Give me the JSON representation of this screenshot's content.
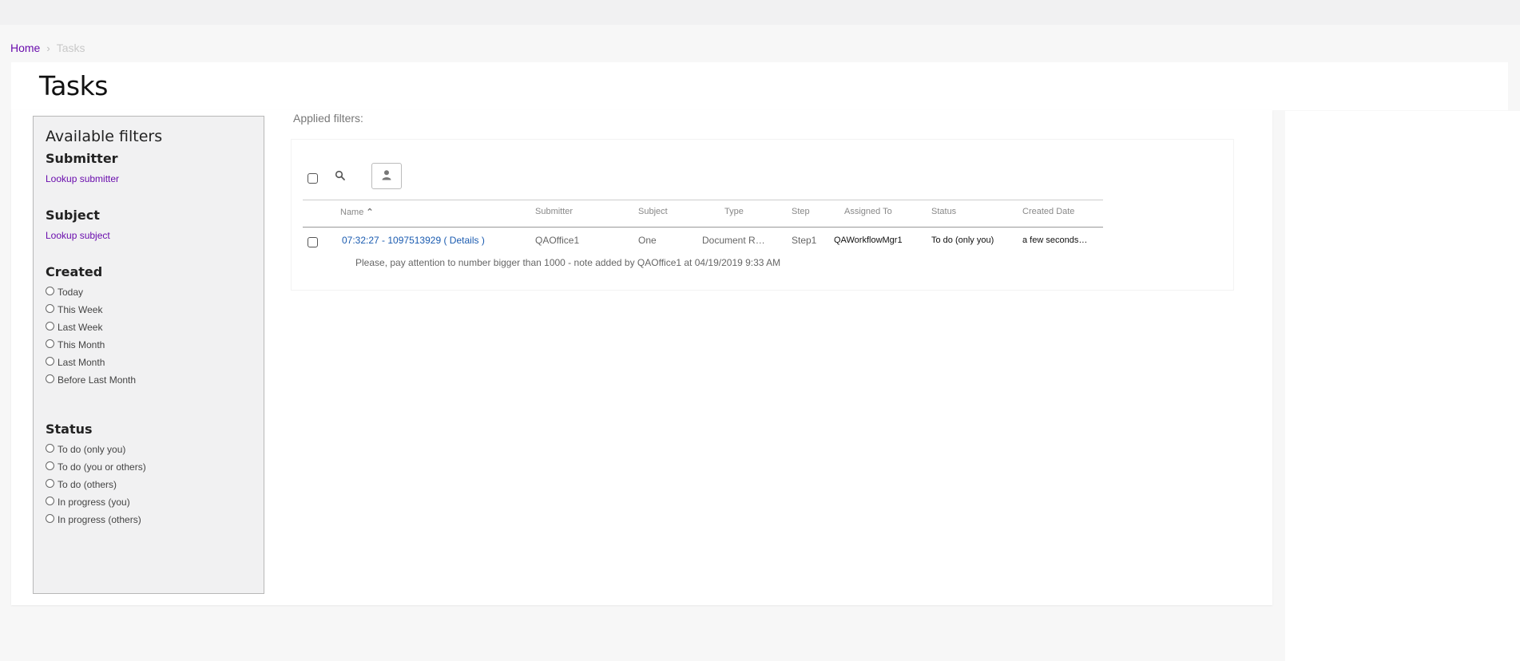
{
  "breadcrumb": {
    "home": "Home",
    "separator": "›",
    "current": "Tasks"
  },
  "page": {
    "title": "Tasks"
  },
  "filters": {
    "title": "Available filters",
    "submitter": {
      "heading": "Submitter",
      "link": "Lookup submitter"
    },
    "subject": {
      "heading": "Subject",
      "link": "Lookup subject"
    },
    "created": {
      "heading": "Created",
      "options": [
        "Today",
        "This Week",
        "Last Week",
        "This Month",
        "Last Month",
        "Before Last Month"
      ]
    },
    "status": {
      "heading": "Status",
      "options": [
        "To do (only you)",
        "To do (you or others)",
        "To do (others)",
        "In progress (you)",
        "In progress (others)"
      ]
    }
  },
  "applied_filters_label": "Applied filters:",
  "toolbar": {
    "search_icon": "search-icon",
    "user_icon": "user-icon"
  },
  "table": {
    "columns": {
      "name": "Name",
      "sort_indicator": "^",
      "submitter": "Submitter",
      "subject": "Subject",
      "type": "Type",
      "step": "Step",
      "assigned_to": "Assigned To",
      "status": "Status",
      "created_date": "Created Date"
    },
    "rows": [
      {
        "name": "07:32:27 - 1097513929",
        "details": "( Details )",
        "submitter": "QAOffice1",
        "subject": "One",
        "type": "Document R…",
        "step": "Step1",
        "assigned_to": "QAWorkflowMgr1",
        "status": "To do (only you)",
        "created_date": "a few seconds…",
        "note": "Please, pay attention to number bigger than 1000 - note added by QAOffice1 at 04/19/2019 9:33 AM"
      }
    ]
  },
  "colors": {
    "link": "#6a0dad",
    "task_link": "#1a5bb0",
    "filter_bg": "#f1f1f2"
  }
}
